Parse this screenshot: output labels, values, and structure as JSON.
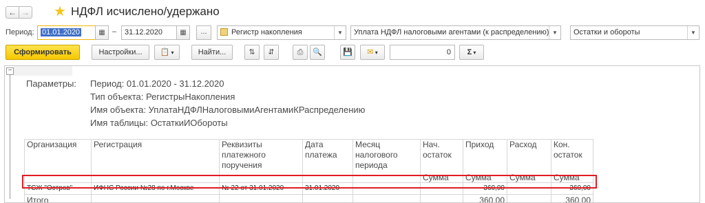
{
  "window": {
    "title": "НДФЛ исчислено/удержано",
    "nav_back": "←",
    "nav_forward": "→",
    "favorite_icon": "star-icon"
  },
  "period": {
    "label": "Период:",
    "from": "01.01.2020",
    "dash": "–",
    "to": "31.12.2020",
    "dots_label": "...",
    "source_type": "Регистр накопления",
    "register": "Уплата НДФЛ налоговыми агентами (к распределению)",
    "table": "Остатки и обороты"
  },
  "toolbar": {
    "generate": "Сформировать",
    "settings": "Настройки...",
    "find": "Найти...",
    "amount_value": "0",
    "sum_label": "Σ"
  },
  "report": {
    "params": [
      {
        "label": "Параметры:",
        "value": "Период: 01.01.2020 - 31.12.2020"
      },
      {
        "label": "",
        "value": "Тип объекта: РегистрыНакопления"
      },
      {
        "label": "",
        "value": "Имя объекта: УплатаНДФЛНалоговымиАгентамиКРаспределению"
      },
      {
        "label": "",
        "value": "Имя таблицы: ОстаткиИОбороты"
      }
    ],
    "columns": [
      {
        "title": "Организация",
        "sub": ""
      },
      {
        "title": "Регистрация",
        "sub": ""
      },
      {
        "title": "Реквизиты платежного поручения",
        "sub": ""
      },
      {
        "title": "Дата платежа",
        "sub": ""
      },
      {
        "title": "Месяц налогового периода",
        "sub": ""
      },
      {
        "title": "Нач. остаток",
        "sub": "Сумма"
      },
      {
        "title": "Приход",
        "sub": "Сумма"
      },
      {
        "title": "Расход",
        "sub": "Сумма"
      },
      {
        "title": "Кон. остаток",
        "sub": "Сумма"
      }
    ],
    "rows": [
      {
        "org": "ТСЖ \"Остров\"",
        "registration": "ИФНС России №28 по г.Москве",
        "payment_order": "№ 22 от 31.01.2020",
        "payment_date": "31.01.2020",
        "tax_month": "",
        "opening": "",
        "income": "360,00",
        "expense": "",
        "closing": "360,00"
      }
    ],
    "total": {
      "label": "Итого",
      "income": "360,00",
      "closing": "360,00"
    },
    "highlight_color": "#e01c24"
  }
}
